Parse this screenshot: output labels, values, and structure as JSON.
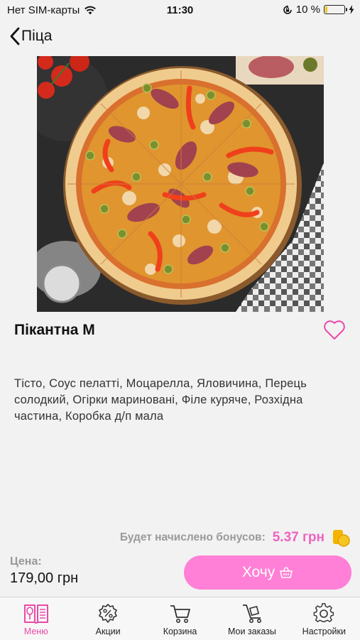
{
  "status_bar": {
    "carrier": "Нет SIM-карты",
    "time": "11:30",
    "battery": "10 %",
    "battery_level": 0.1
  },
  "nav": {
    "back_label": "Піца"
  },
  "product": {
    "title": "Пікантна М",
    "description": "Тісто, Соус пелатті, Моцарелла, Яловичина, Перець солодкий, Огірки мариновані, Філе куряче, Розхідна частина, Коробка д/п мала"
  },
  "bonus": {
    "label": "Будет начислено бонусов:",
    "value": "5.37 грн"
  },
  "price": {
    "label": "Цена:",
    "value": "179,00 грн"
  },
  "cta": {
    "label": "Хочу"
  },
  "tabs": [
    {
      "label": "Меню",
      "icon": "menu-book-icon",
      "active": true
    },
    {
      "label": "Акции",
      "icon": "discount-badge-icon",
      "active": false
    },
    {
      "label": "Корзина",
      "icon": "cart-icon",
      "active": false
    },
    {
      "label": "Мои заказы",
      "icon": "orders-trolley-icon",
      "active": false
    },
    {
      "label": "Настройки",
      "icon": "gear-icon",
      "active": false
    }
  ],
  "colors": {
    "accent": "#f062c0",
    "cta_background": "#ff80d6",
    "active_tab": "#e94aa8",
    "background": "#f2f2f2"
  }
}
